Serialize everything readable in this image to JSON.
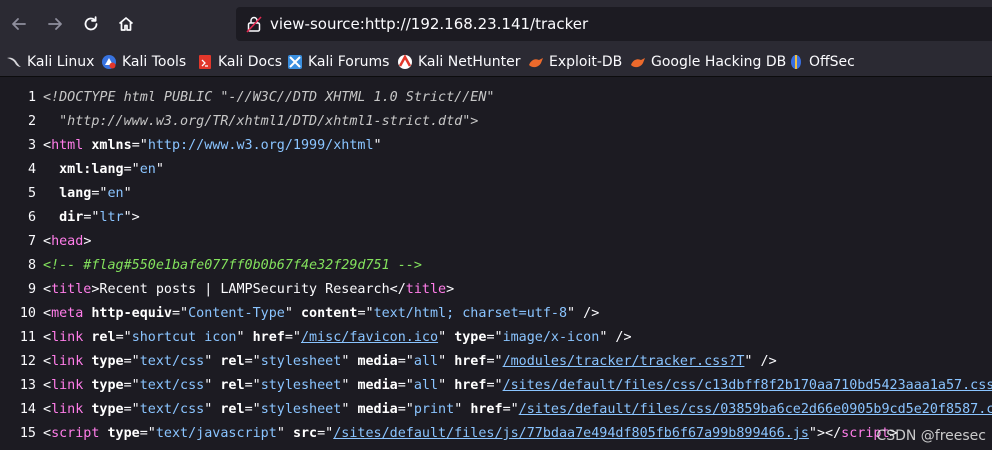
{
  "toolbar": {
    "url": "view-source:http://192.168.23.141/tracker"
  },
  "bookmarks": [
    {
      "label": "Kali Linux",
      "icon": "kali-dragon-icon"
    },
    {
      "label": "Kali Tools",
      "icon": "kali-tools-icon"
    },
    {
      "label": "Kali Docs",
      "icon": "kali-docs-icon"
    },
    {
      "label": "Kali Forums",
      "icon": "kali-forums-icon"
    },
    {
      "label": "Kali NetHunter",
      "icon": "kali-nethunter-icon"
    },
    {
      "label": "Exploit-DB",
      "icon": "exploit-db-icon"
    },
    {
      "label": "Google Hacking DB",
      "icon": "ghdb-icon"
    },
    {
      "label": "OffSec",
      "icon": "offsec-icon"
    }
  ],
  "source_lines": [
    {
      "n": "1",
      "tokens": [
        [
          "doctype",
          "<!DOCTYPE html PUBLIC \"-//W3C//DTD XHTML 1.0 Strict//EN\""
        ]
      ]
    },
    {
      "n": "2",
      "tokens": [
        [
          "doctype",
          "  \"http://www.w3.org/TR/xhtml1/DTD/xhtml1-strict.dtd\">"
        ]
      ]
    },
    {
      "n": "3",
      "tokens": [
        [
          "txt",
          "<"
        ],
        [
          "tag",
          "html"
        ],
        [
          "txt",
          " "
        ],
        [
          "attr",
          "xmlns"
        ],
        [
          "txt",
          "=\""
        ],
        [
          "val",
          "http://www.w3.org/1999/xhtml"
        ],
        [
          "txt",
          "\""
        ]
      ]
    },
    {
      "n": "4",
      "tokens": [
        [
          "txt",
          "  "
        ],
        [
          "attr",
          "xml:lang"
        ],
        [
          "txt",
          "=\""
        ],
        [
          "val",
          "en"
        ],
        [
          "txt",
          "\""
        ]
      ]
    },
    {
      "n": "5",
      "tokens": [
        [
          "txt",
          "  "
        ],
        [
          "attr",
          "lang"
        ],
        [
          "txt",
          "=\""
        ],
        [
          "val",
          "en"
        ],
        [
          "txt",
          "\""
        ]
      ]
    },
    {
      "n": "6",
      "tokens": [
        [
          "txt",
          "  "
        ],
        [
          "attr",
          "dir"
        ],
        [
          "txt",
          "=\""
        ],
        [
          "val",
          "ltr"
        ],
        [
          "txt",
          "\">"
        ]
      ]
    },
    {
      "n": "7",
      "tokens": [
        [
          "txt",
          "<"
        ],
        [
          "tag",
          "head"
        ],
        [
          "txt",
          ">"
        ]
      ]
    },
    {
      "n": "8",
      "tokens": [
        [
          "comment",
          "<!-- #flag#550e1bafe077ff0b0b67f4e32f29d751 -->"
        ]
      ]
    },
    {
      "n": "9",
      "tokens": [
        [
          "txt",
          "<"
        ],
        [
          "tag",
          "title"
        ],
        [
          "txt",
          ">Recent posts | LAMPSecurity Research</"
        ],
        [
          "tag",
          "title"
        ],
        [
          "txt",
          ">"
        ]
      ]
    },
    {
      "n": "10",
      "tokens": [
        [
          "txt",
          "<"
        ],
        [
          "tag",
          "meta"
        ],
        [
          "txt",
          " "
        ],
        [
          "attr",
          "http-equiv"
        ],
        [
          "txt",
          "=\""
        ],
        [
          "val",
          "Content-Type"
        ],
        [
          "txt",
          "\" "
        ],
        [
          "attr",
          "content"
        ],
        [
          "txt",
          "=\""
        ],
        [
          "val",
          "text/html; charset=utf-8"
        ],
        [
          "txt",
          "\" />"
        ]
      ]
    },
    {
      "n": "11",
      "tokens": [
        [
          "txt",
          "<"
        ],
        [
          "tag",
          "link"
        ],
        [
          "txt",
          " "
        ],
        [
          "attr",
          "rel"
        ],
        [
          "txt",
          "=\""
        ],
        [
          "val",
          "shortcut icon"
        ],
        [
          "txt",
          "\" "
        ],
        [
          "attr",
          "href"
        ],
        [
          "txt",
          "=\""
        ],
        [
          "link",
          "/misc/favicon.ico"
        ],
        [
          "txt",
          "\" "
        ],
        [
          "attr",
          "type"
        ],
        [
          "txt",
          "=\""
        ],
        [
          "val",
          "image/x-icon"
        ],
        [
          "txt",
          "\" />"
        ]
      ]
    },
    {
      "n": "12",
      "tokens": [
        [
          "txt",
          "<"
        ],
        [
          "tag",
          "link"
        ],
        [
          "txt",
          " "
        ],
        [
          "attr",
          "type"
        ],
        [
          "txt",
          "=\""
        ],
        [
          "val",
          "text/css"
        ],
        [
          "txt",
          "\" "
        ],
        [
          "attr",
          "rel"
        ],
        [
          "txt",
          "=\""
        ],
        [
          "val",
          "stylesheet"
        ],
        [
          "txt",
          "\" "
        ],
        [
          "attr",
          "media"
        ],
        [
          "txt",
          "=\""
        ],
        [
          "val",
          "all"
        ],
        [
          "txt",
          "\" "
        ],
        [
          "attr",
          "href"
        ],
        [
          "txt",
          "=\""
        ],
        [
          "link",
          "/modules/tracker/tracker.css?T"
        ],
        [
          "txt",
          "\" />"
        ]
      ]
    },
    {
      "n": "13",
      "tokens": [
        [
          "txt",
          "<"
        ],
        [
          "tag",
          "link"
        ],
        [
          "txt",
          " "
        ],
        [
          "attr",
          "type"
        ],
        [
          "txt",
          "=\""
        ],
        [
          "val",
          "text/css"
        ],
        [
          "txt",
          "\" "
        ],
        [
          "attr",
          "rel"
        ],
        [
          "txt",
          "=\""
        ],
        [
          "val",
          "stylesheet"
        ],
        [
          "txt",
          "\" "
        ],
        [
          "attr",
          "media"
        ],
        [
          "txt",
          "=\""
        ],
        [
          "val",
          "all"
        ],
        [
          "txt",
          "\" "
        ],
        [
          "attr",
          "href"
        ],
        [
          "txt",
          "=\""
        ],
        [
          "link",
          "/sites/default/files/css/c13dbff8f2b170aa710bd5423aaa1a57.css"
        ],
        [
          "txt",
          "\""
        ]
      ]
    },
    {
      "n": "14",
      "tokens": [
        [
          "txt",
          "<"
        ],
        [
          "tag",
          "link"
        ],
        [
          "txt",
          " "
        ],
        [
          "attr",
          "type"
        ],
        [
          "txt",
          "=\""
        ],
        [
          "val",
          "text/css"
        ],
        [
          "txt",
          "\" "
        ],
        [
          "attr",
          "rel"
        ],
        [
          "txt",
          "=\""
        ],
        [
          "val",
          "stylesheet"
        ],
        [
          "txt",
          "\" "
        ],
        [
          "attr",
          "media"
        ],
        [
          "txt",
          "=\""
        ],
        [
          "val",
          "print"
        ],
        [
          "txt",
          "\" "
        ],
        [
          "attr",
          "href"
        ],
        [
          "txt",
          "=\""
        ],
        [
          "link",
          "/sites/default/files/css/03859ba6ce2d66e0905b9cd5e20f8587.css"
        ]
      ]
    },
    {
      "n": "15",
      "tokens": [
        [
          "txt",
          "<"
        ],
        [
          "tag",
          "script"
        ],
        [
          "txt",
          " "
        ],
        [
          "attr",
          "type"
        ],
        [
          "txt",
          "=\""
        ],
        [
          "val",
          "text/javascript"
        ],
        [
          "txt",
          "\" "
        ],
        [
          "attr",
          "src"
        ],
        [
          "txt",
          "=\""
        ],
        [
          "link",
          "/sites/default/files/js/77bdaa7e494df805fb6f67a99b899466.js"
        ],
        [
          "txt",
          "\"></"
        ],
        [
          "tag",
          "script"
        ],
        [
          "txt",
          ">"
        ]
      ]
    }
  ],
  "watermark": "CSDN @freesec"
}
